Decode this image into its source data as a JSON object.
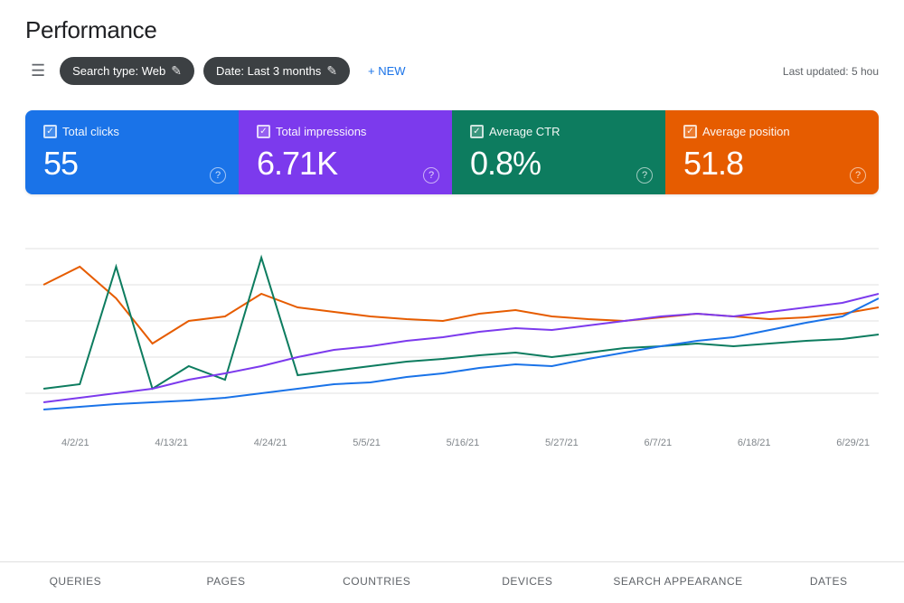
{
  "header": {
    "title": "Performance",
    "last_updated": "Last updated: 5 hou"
  },
  "toolbar": {
    "filter_icon": "≡",
    "search_type_chip": "Search type: Web",
    "date_chip": "Date: Last 3 months",
    "new_button": "+ NEW",
    "edit_icon": "✎"
  },
  "metrics": [
    {
      "id": "total-clicks",
      "label": "Total clicks",
      "value": "55",
      "color": "blue",
      "color_hex": "#1a73e8"
    },
    {
      "id": "total-impressions",
      "label": "Total impressions",
      "value": "6.71K",
      "color": "purple",
      "color_hex": "#7c3aed"
    },
    {
      "id": "average-ctr",
      "label": "Average CTR",
      "value": "0.8%",
      "color": "teal",
      "color_hex": "#0d7c5f"
    },
    {
      "id": "average-position",
      "label": "Average position",
      "value": "51.8",
      "color": "orange",
      "color_hex": "#e65c00"
    }
  ],
  "chart": {
    "x_labels": [
      "4/2/21",
      "4/13/21",
      "4/24/21",
      "5/5/21",
      "5/16/21",
      "5/27/21",
      "6/7/21",
      "6/18/21",
      "6/29/21"
    ],
    "series": {
      "clicks": {
        "color": "#1a73e8",
        "label": "Total clicks"
      },
      "impressions": {
        "color": "#7c3aed",
        "label": "Total impressions"
      },
      "ctr": {
        "color": "#0d7c5f",
        "label": "Average CTR"
      },
      "position": {
        "color": "#e65c00",
        "label": "Average position"
      }
    }
  },
  "bottom_tabs": [
    {
      "label": "QUERIES",
      "active": false
    },
    {
      "label": "PAGES",
      "active": false
    },
    {
      "label": "COUNTRIES",
      "active": false
    },
    {
      "label": "DEVICES",
      "active": false
    },
    {
      "label": "SEARCH APPEARANCE",
      "active": false
    },
    {
      "label": "DATES",
      "active": false
    }
  ]
}
